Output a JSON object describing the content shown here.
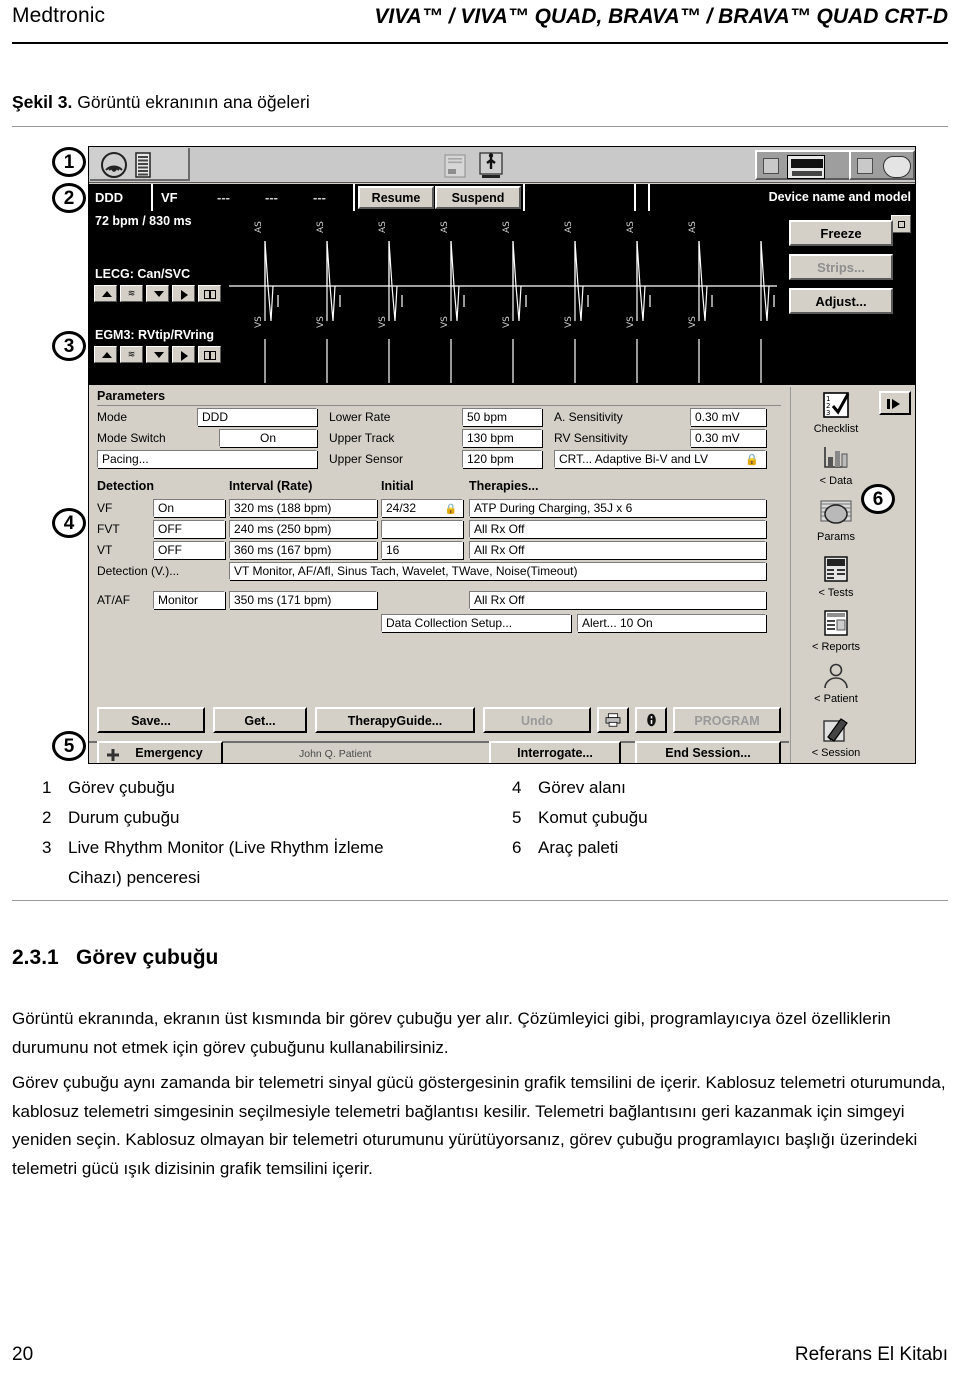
{
  "running_head": {
    "brand": "Medtronic",
    "document_title": "VIVA™ / VIVA™ QUAD, BRAVA™ / BRAVA™ QUAD CRT-D"
  },
  "figure": {
    "label": "Şekil 3.",
    "caption": "Görüntü ekranının ana öğeleri",
    "callouts": [
      "1",
      "2",
      "3",
      "4",
      "5",
      "6"
    ]
  },
  "screenshot": {
    "taskbar": {
      "icons": [
        "telemetry-signal-icon",
        "battery-icon",
        "card-reader-icon",
        "usb-icon",
        "device-display-icon",
        "programming-head-icon"
      ]
    },
    "statusbar": {
      "mode": "DDD",
      "vf": "VF",
      "dashes": [
        "---",
        "---",
        "---"
      ],
      "resume_label": "Resume",
      "suspend_label": "Suspend",
      "device_name": "Device name and model"
    },
    "live_rhythm_monitor": {
      "rate": "72 bpm / 830 ms",
      "channel1": "LECG: Can/SVC",
      "channel2": "EGM3: RVtip/RVring",
      "marker_top": "AS",
      "marker_bottom": "VS",
      "strip_buttons": [
        "up-arrow-button",
        "scale-button",
        "down-arrow-button",
        "play-button",
        "split-button"
      ],
      "freeze_label": "Freeze",
      "strips_label": "Strips...",
      "adjust_label": "Adjust..."
    },
    "parameters": {
      "heading": "Parameters",
      "rows": [
        {
          "label": "Mode",
          "value": "DDD",
          "mid_label": "Lower Rate",
          "mid_value": "50 bpm",
          "right_label": "A. Sensitivity",
          "right_value": "0.30 mV"
        },
        {
          "label": "Mode Switch",
          "value": "On",
          "mid_label": "Upper Track",
          "mid_value": "130 bpm",
          "right_label": "RV Sensitivity",
          "right_value": "0.30 mV"
        }
      ],
      "pacing_label": "Pacing...",
      "upper_sensor_label": "Upper Sensor",
      "upper_sensor_value": "120 bpm",
      "crt_value": "CRT...  Adaptive Bi-V and LV"
    },
    "detection": {
      "headers": [
        "Detection",
        "Interval (Rate)",
        "Initial",
        "Therapies..."
      ],
      "rows": [
        {
          "zone": "VF",
          "state": "On",
          "interval": "320 ms (188 bpm)",
          "initial": "24/32",
          "therapy": "ATP During Charging, 35J x 6",
          "has_lock": true
        },
        {
          "zone": "FVT",
          "state": "OFF",
          "interval": "240 ms (250 bpm)",
          "initial": "",
          "therapy": "All Rx Off",
          "has_lock": false
        },
        {
          "zone": "VT",
          "state": "OFF",
          "interval": "360 ms (167 bpm)",
          "initial": "16",
          "therapy": "All Rx Off",
          "has_lock": false
        }
      ],
      "detection_v_label": "Detection (V.)...",
      "detection_v_value": "VT Monitor, AF/Afl, Sinus Tach, Wavelet, TWave, Noise(Timeout)",
      "atafLabel": "AT/AF",
      "ataf_state": "Monitor",
      "ataf_interval": "350 ms (171 bpm)",
      "ataf_therapy": "All Rx Off",
      "data_collection_label": "Data Collection Setup...",
      "alert_label": "Alert...  10 On"
    },
    "command_buttons": {
      "save": "Save...",
      "get": "Get...",
      "therapy_guide": "TherapyGuide...",
      "undo": "Undo",
      "print": "print-icon",
      "info": "info-icon",
      "program": "PROGRAM"
    },
    "command_bar": {
      "emergency": "Emergency",
      "patient_name": "John Q. Patient",
      "interrogate": "Interrogate...",
      "end_session": "End Session..."
    },
    "palette": {
      "items": [
        {
          "label": "Checklist",
          "icon": "checklist-icon"
        },
        {
          "label": "< Data",
          "icon": "bar-chart-icon"
        },
        {
          "label": "Params",
          "icon": "params-icon"
        },
        {
          "label": "< Tests",
          "icon": "tests-icon"
        },
        {
          "label": "< Reports",
          "icon": "reports-icon"
        },
        {
          "label": "< Patient",
          "icon": "patient-icon"
        },
        {
          "label": "< Session",
          "icon": "session-icon"
        }
      ],
      "next_button": "next-arrow-button"
    }
  },
  "legend": {
    "left": [
      {
        "n": "1",
        "text": "Görev çubuğu"
      },
      {
        "n": "2",
        "text": "Durum çubuğu"
      },
      {
        "n": "3",
        "text": "Live Rhythm Monitor (Live Rhythm İzleme",
        "text2": "Cihazı) penceresi"
      }
    ],
    "right": [
      {
        "n": "4",
        "text": "Görev alanı"
      },
      {
        "n": "5",
        "text": "Komut çubuğu"
      },
      {
        "n": "6",
        "text": "Araç paleti"
      }
    ]
  },
  "section": {
    "number": "2.3.1",
    "title": "Görev çubuğu",
    "paragraph1": "Görüntü ekranında, ekranın üst kısmında bir görev çubuğu yer alır. Çözümleyici gibi, programlayıcıya özel özelliklerin durumunu not etmek için görev çubuğunu kullanabilirsiniz.",
    "paragraph2": "Görev çubuğu aynı zamanda bir telemetri sinyal gücü göstergesinin grafik temsilini de içerir. Kablosuz telemetri oturumunda, kablosuz telemetri simgesinin seçilmesiyle telemetri bağlantısı kesilir. Telemetri bağlantısını geri kazanmak için simgeyi yeniden seçin. Kablosuz olmayan bir telemetri oturumunu yürütüyorsanız, görev çubuğu programlayıcı başlığı üzerindeki telemetri gücü ışık dizisinin grafik temsilini içerir."
  },
  "footer": {
    "page_number": "20",
    "manual_title": "Referans El Kitabı"
  }
}
